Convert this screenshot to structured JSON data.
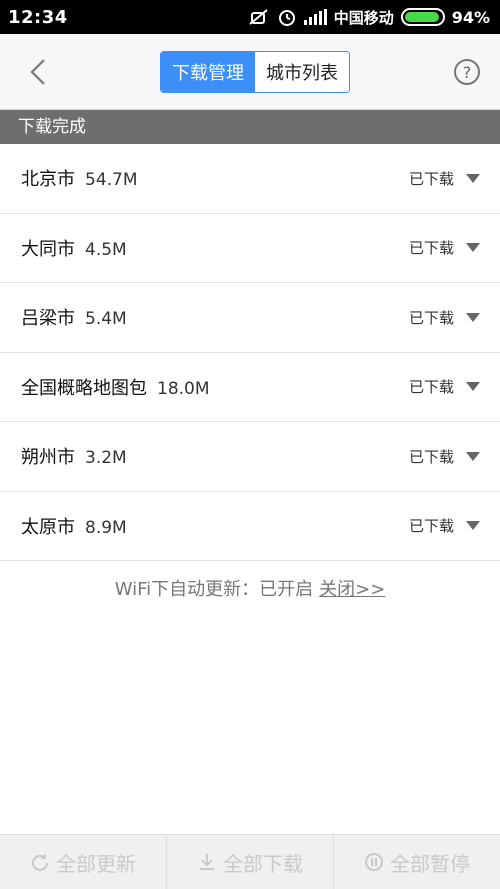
{
  "status_bar": {
    "time": "12:34",
    "carrier": "中国移动",
    "battery": "94%",
    "battery_level": 0.94,
    "icons": [
      "mute-icon",
      "alarm-icon",
      "signal-icon",
      "battery-icon"
    ]
  },
  "header": {
    "tabs": [
      {
        "label": "下载管理",
        "active": true
      },
      {
        "label": "城市列表",
        "active": false
      }
    ],
    "help_label": "?"
  },
  "section": {
    "title": "下载完成"
  },
  "downloads": [
    {
      "name": "北京市",
      "size": "54.7M",
      "status": "已下载"
    },
    {
      "name": "大同市",
      "size": "4.5M",
      "status": "已下载"
    },
    {
      "name": "吕梁市",
      "size": "5.4M",
      "status": "已下载"
    },
    {
      "name": "全国概略地图包",
      "size": "18.0M",
      "status": "已下载"
    },
    {
      "name": "朔州市",
      "size": "3.2M",
      "status": "已下载"
    },
    {
      "name": "太原市",
      "size": "8.9M",
      "status": "已下载"
    }
  ],
  "wifi_notice": {
    "text": "WiFi下自动更新：已开启",
    "link": "关闭>>"
  },
  "bottom_bar": {
    "update_all": "全部更新",
    "download_all": "全部下载",
    "pause_all": "全部暂停"
  },
  "colors": {
    "accent": "#3e8ef7",
    "section_bg": "#6e6e6e",
    "status_bar_bg": "#000000",
    "battery_fill": "#48d848"
  }
}
